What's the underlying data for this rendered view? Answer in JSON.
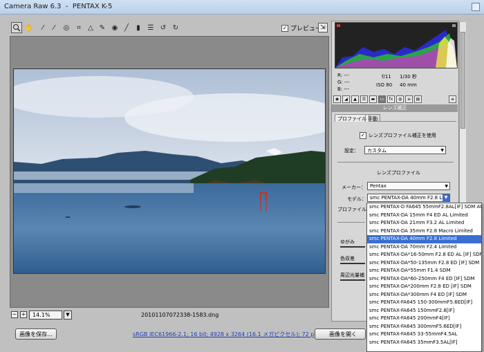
{
  "window": {
    "title": "Camera Raw 6.3  -  PENTAX K-5"
  },
  "toolbar": {
    "tools": [
      "zoom-icon",
      "hand-icon",
      "white-balance-icon",
      "color-sampler-icon",
      "target-adjust-icon",
      "crop-icon",
      "straighten-icon",
      "spot-removal-icon",
      "red-eye-icon",
      "adjustment-brush-icon",
      "graduated-filter-icon",
      "preferences-icon",
      "rotate-left-icon",
      "rotate-right-icon"
    ],
    "preview_label": "プレビュー",
    "preview_checked": true
  },
  "zoom": {
    "value": "14.1%"
  },
  "status": {
    "filename": "20101107072338-1583.dng"
  },
  "bottom": {
    "save_button": "画像を保存...",
    "info_link": "sRGB IEC61966-2.1; 16 bit; 4928 x 3264 (16.1 メガピクセル); 72 ppi",
    "open_button": "画像を開く"
  },
  "readout": {
    "r": "R:   ---",
    "g": "G:   ---",
    "b": "B:   ---",
    "aperture": "f/11",
    "shutter": "1/30 秒",
    "iso": "ISO 80",
    "focal": "40 mm"
  },
  "panel": {
    "section_title": "レンズ補正",
    "tab_profile": "プロファイル",
    "tab_manual": "手動",
    "enable_label": "レンズプロファイル補正を使用",
    "enable_checked": true,
    "setup_label": "設定：",
    "setup_value": "カスタム",
    "lens_profile_heading": "レンズプロファイル",
    "make_label": "メーカー：",
    "make_value": "Pentax",
    "model_label": "モデル：",
    "model_value": "smc PENTAX-DA 40mm F2.8 Limi...",
    "profile_label": "プロファイル：",
    "distortion_label": "ゆがみ",
    "ca_label": "色収差",
    "vignette_label": "周辺光量補"
  },
  "dropdown": {
    "items": [
      "smc PENTAX-D FA645 55mmF2.8AL[IF] SDM AW",
      "smc PENTAX-DA 15mm F4 ED AL Limited",
      "smc PENTAX-DA 21mm F3.2 AL Limited",
      "smc PENTAX-DA 35mm F2.8 Macro Limited",
      "smc PENTAX-DA 40mm F2.8 Limited",
      "smc PENTAX-DA 70mm F2.4 Limited",
      "smc PENTAX-DA*16-50mm F2.8 ED AL [IF] SDM",
      "smc PENTAX-DA*50-135mm F2.8 ED [IF] SDM",
      "smc PENTAX-DA*55mm F1.4 SDM",
      "smc PENTAX-DA*60-250mm F4 ED [IF] SDM",
      "smc PENTAX-DA*200mm F2.8 ED [IF] SDM",
      "smc PENTAX-DA*300mm F4 ED [IF] SDM",
      "smc PENTAX-FA645 150-300mmF5.6ED[IF]",
      "smc PENTAX-FA645 150mmF2.8[IF]",
      "smc PENTAX-FA645 200mmF4[IF]",
      "smc PENTAX-FA645 300mmF5.6ED[IF]",
      "smc PENTAX-FA645 33-55mmF4.5AL",
      "smc PENTAX-FA645 35mmF3.5AL[IF]"
    ],
    "selected_index": 4
  }
}
